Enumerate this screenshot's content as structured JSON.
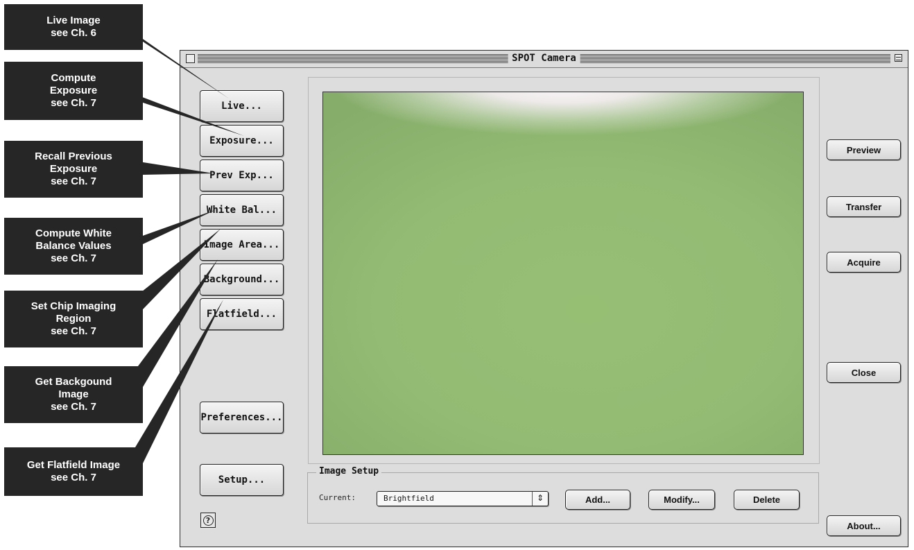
{
  "window": {
    "title": "SPOT Camera",
    "left_buttons": [
      "Live...",
      "Exposure...",
      "Prev Exp...",
      "White Bal...",
      "Image Area...",
      "Background...",
      "Flatfield...",
      "Preferences...",
      "Setup..."
    ],
    "right_buttons": {
      "preview": "Preview",
      "transfer": "Transfer",
      "acquire": "Acquire",
      "close": "Close",
      "about": "About..."
    },
    "image_setup": {
      "group_title": "Image Setup",
      "current_label": "Current:",
      "current_value": "Brightfield",
      "add": "Add...",
      "modify": "Modify...",
      "delete": "Delete"
    },
    "help_icon": "question-icon",
    "preview_colors": {
      "green": "#94bc72",
      "highlight": "#f8f0f6"
    }
  },
  "callouts": [
    {
      "lines": [
        "Live Image",
        "see Ch. 6"
      ]
    },
    {
      "lines": [
        "Compute",
        "Exposure",
        "see Ch. 7"
      ]
    },
    {
      "lines": [
        "Recall Previous",
        "Exposure",
        "see Ch. 7"
      ]
    },
    {
      "lines": [
        "Compute White",
        "Balance Values",
        "see Ch. 7"
      ]
    },
    {
      "lines": [
        "Set Chip Imaging",
        "Region",
        "see Ch. 7"
      ]
    },
    {
      "lines": [
        "Get Backgound",
        "Image",
        "see Ch. 7"
      ]
    },
    {
      "lines": [
        "Get Flatfield Image",
        "see Ch. 7"
      ]
    }
  ]
}
